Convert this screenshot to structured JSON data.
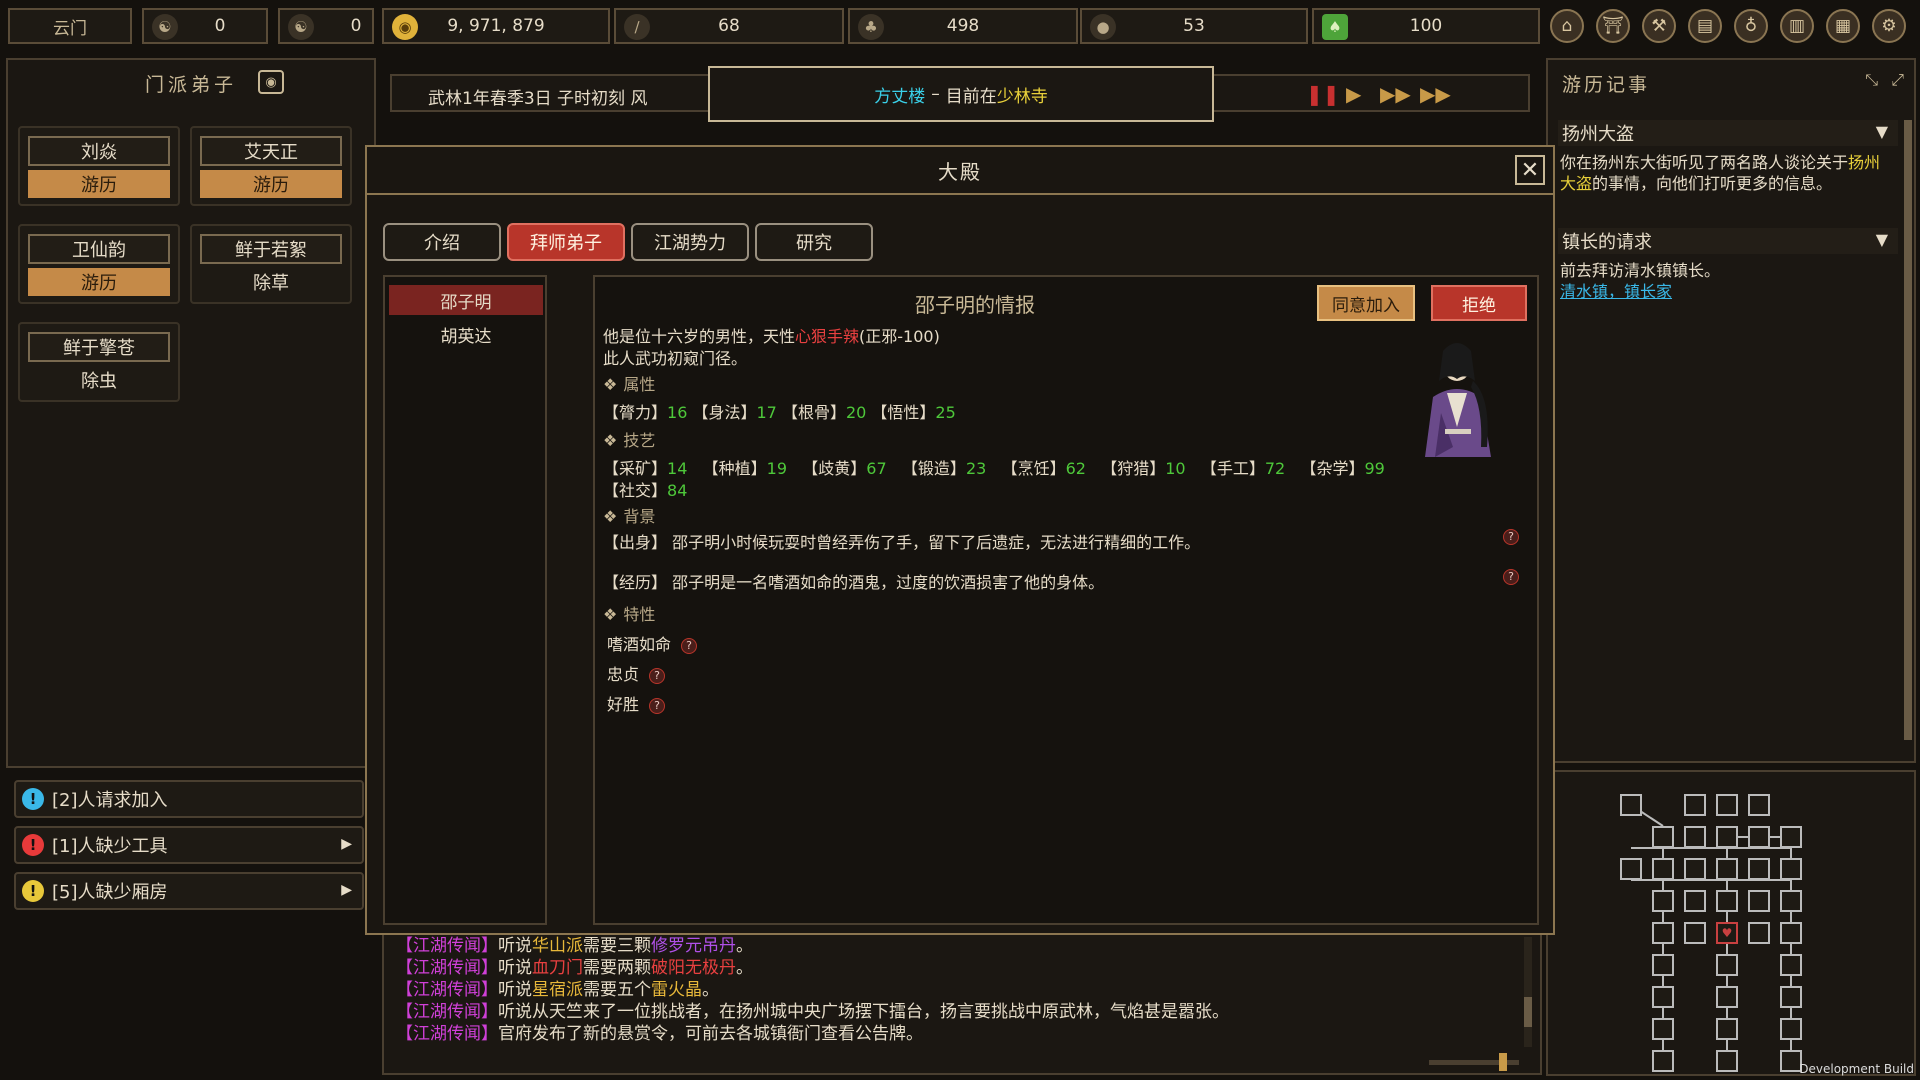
{
  "topbar": {
    "sect_name": "云门",
    "resources": [
      {
        "icon": "fame-icon",
        "value": "0"
      },
      {
        "icon": "yinyang-icon",
        "value": "0"
      },
      {
        "icon": "coin-icon",
        "value": "9, 971, 879"
      },
      {
        "icon": "wood-icon",
        "value": "68"
      },
      {
        "icon": "grain-icon",
        "value": "498"
      },
      {
        "icon": "stone-icon",
        "value": "53"
      },
      {
        "icon": "herb-icon",
        "value": "100"
      }
    ],
    "menu_icons": [
      "building-icon",
      "gate-icon",
      "tools-icon",
      "scroll-icon",
      "bag-icon",
      "book-icon",
      "manual-icon",
      "settings-icon"
    ]
  },
  "sect_panel": {
    "title": "门派弟子",
    "disciples": [
      {
        "name": "刘焱",
        "activity": "游历",
        "busy": true
      },
      {
        "name": "艾天正",
        "activity": "游历",
        "busy": true
      },
      {
        "name": "卫仙韵",
        "activity": "游历",
        "busy": true
      },
      {
        "name": "鲜于若絮",
        "activity": "除草",
        "busy": false
      },
      {
        "name": "鲜于擎苍",
        "activity": "除虫",
        "busy": false
      }
    ]
  },
  "alerts": [
    {
      "text": "[2]人请求加入",
      "color": "#3ab8e8",
      "symbol": "!"
    },
    {
      "text": "[1]人缺少工具",
      "color": "#e83a3a",
      "symbol": "!"
    },
    {
      "text": "[5]人缺少厢房",
      "color": "#e8c83a",
      "symbol": "!"
    }
  ],
  "datebar": {
    "date": "武林1年春季3日  子时初刻  风",
    "loc_building": "方丈楼",
    "loc_sep": " – ",
    "loc_prefix": "目前在",
    "loc_place": "少林寺"
  },
  "chronicle": {
    "title": "游历记事",
    "entries": [
      {
        "heading": "扬州大盗",
        "body_pre": "你在扬州东大街听见了两名路人谈论关于",
        "body_hl": "扬州大盗",
        "body_post": "的事情，向他们打听更多的信息。"
      },
      {
        "heading": "镇长的请求",
        "body": "前去拜访清水镇镇长。",
        "link": "清水镇，镇长家"
      }
    ]
  },
  "news": [
    {
      "tag": "【江湖传闻】",
      "pre": "听说",
      "a": "华山派",
      "mid": "需要三颗",
      "b": "修罗元吊丹",
      "post": "。"
    },
    {
      "tag": "【江湖传闻】",
      "pre": "听说",
      "a": "血刀门",
      "mid": "需要两颗",
      "b": "破阳无极丹",
      "post": "。"
    },
    {
      "tag": "【江湖传闻】",
      "pre": "听说",
      "a": "星宿派",
      "mid": "需要五个",
      "b": "雷火晶",
      "post": "。"
    },
    {
      "tag": "【江湖传闻】",
      "text": "听说从天竺来了一位挑战者，在扬州城中央广场摆下擂台，扬言要挑战中原武林，气焰甚是嚣张。"
    },
    {
      "tag": "【江湖传闻】",
      "text": "官府发布了新的悬赏令，可前去各城镇衙门查看公告牌。"
    }
  ],
  "modal": {
    "title": "大殿",
    "tabs": [
      "介绍",
      "拜师弟子",
      "江湖势力",
      "研究"
    ],
    "active_tab": 1,
    "candidates": [
      "邵子明",
      "胡英达"
    ],
    "selected": 0,
    "detail": {
      "title": "邵子明的情报",
      "accept": "同意加入",
      "reject": "拒绝",
      "intro_pre": "他是位十六岁的男性，天性",
      "intro_trait": "心狠手辣",
      "intro_post": "(正邪-100)",
      "martial": "此人武功初窥门径。",
      "attr_header": "属性",
      "attributes": [
        {
          "name": "【膂力】",
          "value": "16"
        },
        {
          "name": "【身法】",
          "value": "17"
        },
        {
          "name": "【根骨】",
          "value": "20"
        },
        {
          "name": "【悟性】",
          "value": "25"
        }
      ],
      "skill_header": "技艺",
      "skills": [
        {
          "name": "【采矿】",
          "value": "14"
        },
        {
          "name": "【种植】",
          "value": "19"
        },
        {
          "name": "【歧黄】",
          "value": "67"
        },
        {
          "name": "【锻造】",
          "value": "23"
        },
        {
          "name": "【烹饪】",
          "value": "62"
        },
        {
          "name": "【狩猎】",
          "value": "10"
        },
        {
          "name": "【手工】",
          "value": "72"
        },
        {
          "name": "【杂学】",
          "value": "99"
        },
        {
          "name": "【社交】",
          "value": "84"
        }
      ],
      "bg_header": "背景",
      "origin_label": "【出身】",
      "origin": "邵子明小时候玩耍时曾经弄伤了手，留下了后遗症，无法进行精细的工作。",
      "exp_label": "【经历】",
      "experience": "邵子明是一名嗜酒如命的酒鬼，过度的饮酒损害了他的身体。",
      "trait_header": "特性",
      "traits": [
        "嗜酒如命",
        "忠贞",
        "好胜"
      ]
    }
  },
  "footer": {
    "build": "Development Build"
  }
}
